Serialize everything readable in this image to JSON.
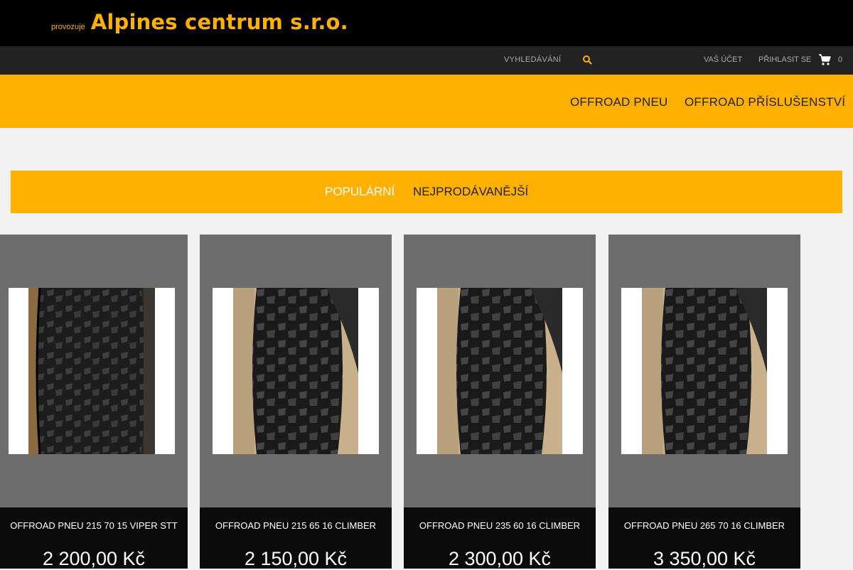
{
  "header": {
    "operator_label": "provozuje",
    "company_name": "Alpines centrum s.r.o."
  },
  "utility": {
    "search_label": "VYHLEDÁVÁNÍ",
    "account_label": "VAŠ ÚČET",
    "login_label": "PŘIHLASIT SE",
    "cart_count": "0"
  },
  "nav": {
    "items": [
      {
        "label": "OFFROAD PNEU"
      },
      {
        "label": "OFFROAD PŘÍSLUŠENSTVÍ"
      }
    ]
  },
  "tabs": {
    "items": [
      {
        "label": "POPULÁRNÍ",
        "active": true
      },
      {
        "label": "NEJPRODÁVANĚJŠÍ",
        "active": false
      }
    ]
  },
  "products": [
    {
      "title": "OFFROAD PNEU 215 70 15 VIPER STT",
      "price": "2 200,00 Kč"
    },
    {
      "title": "OFFROAD PNEU 215 65 16 CLIMBER",
      "price": "2 150,00 Kč"
    },
    {
      "title": "OFFROAD PNEU 235 60 16 CLIMBER",
      "price": "2 300,00 Kč"
    },
    {
      "title": "OFFROAD PNEU 265 70 16 CLIMBER",
      "price": "3 350,00 Kč"
    }
  ],
  "colors": {
    "accent": "#ffb000",
    "topbar": "#000000",
    "utilbar": "#222222",
    "card_bg": "#6d6d6d",
    "card_footer": "#0b0b0b"
  },
  "icons": {
    "search": "search-icon",
    "cart": "cart-icon"
  }
}
